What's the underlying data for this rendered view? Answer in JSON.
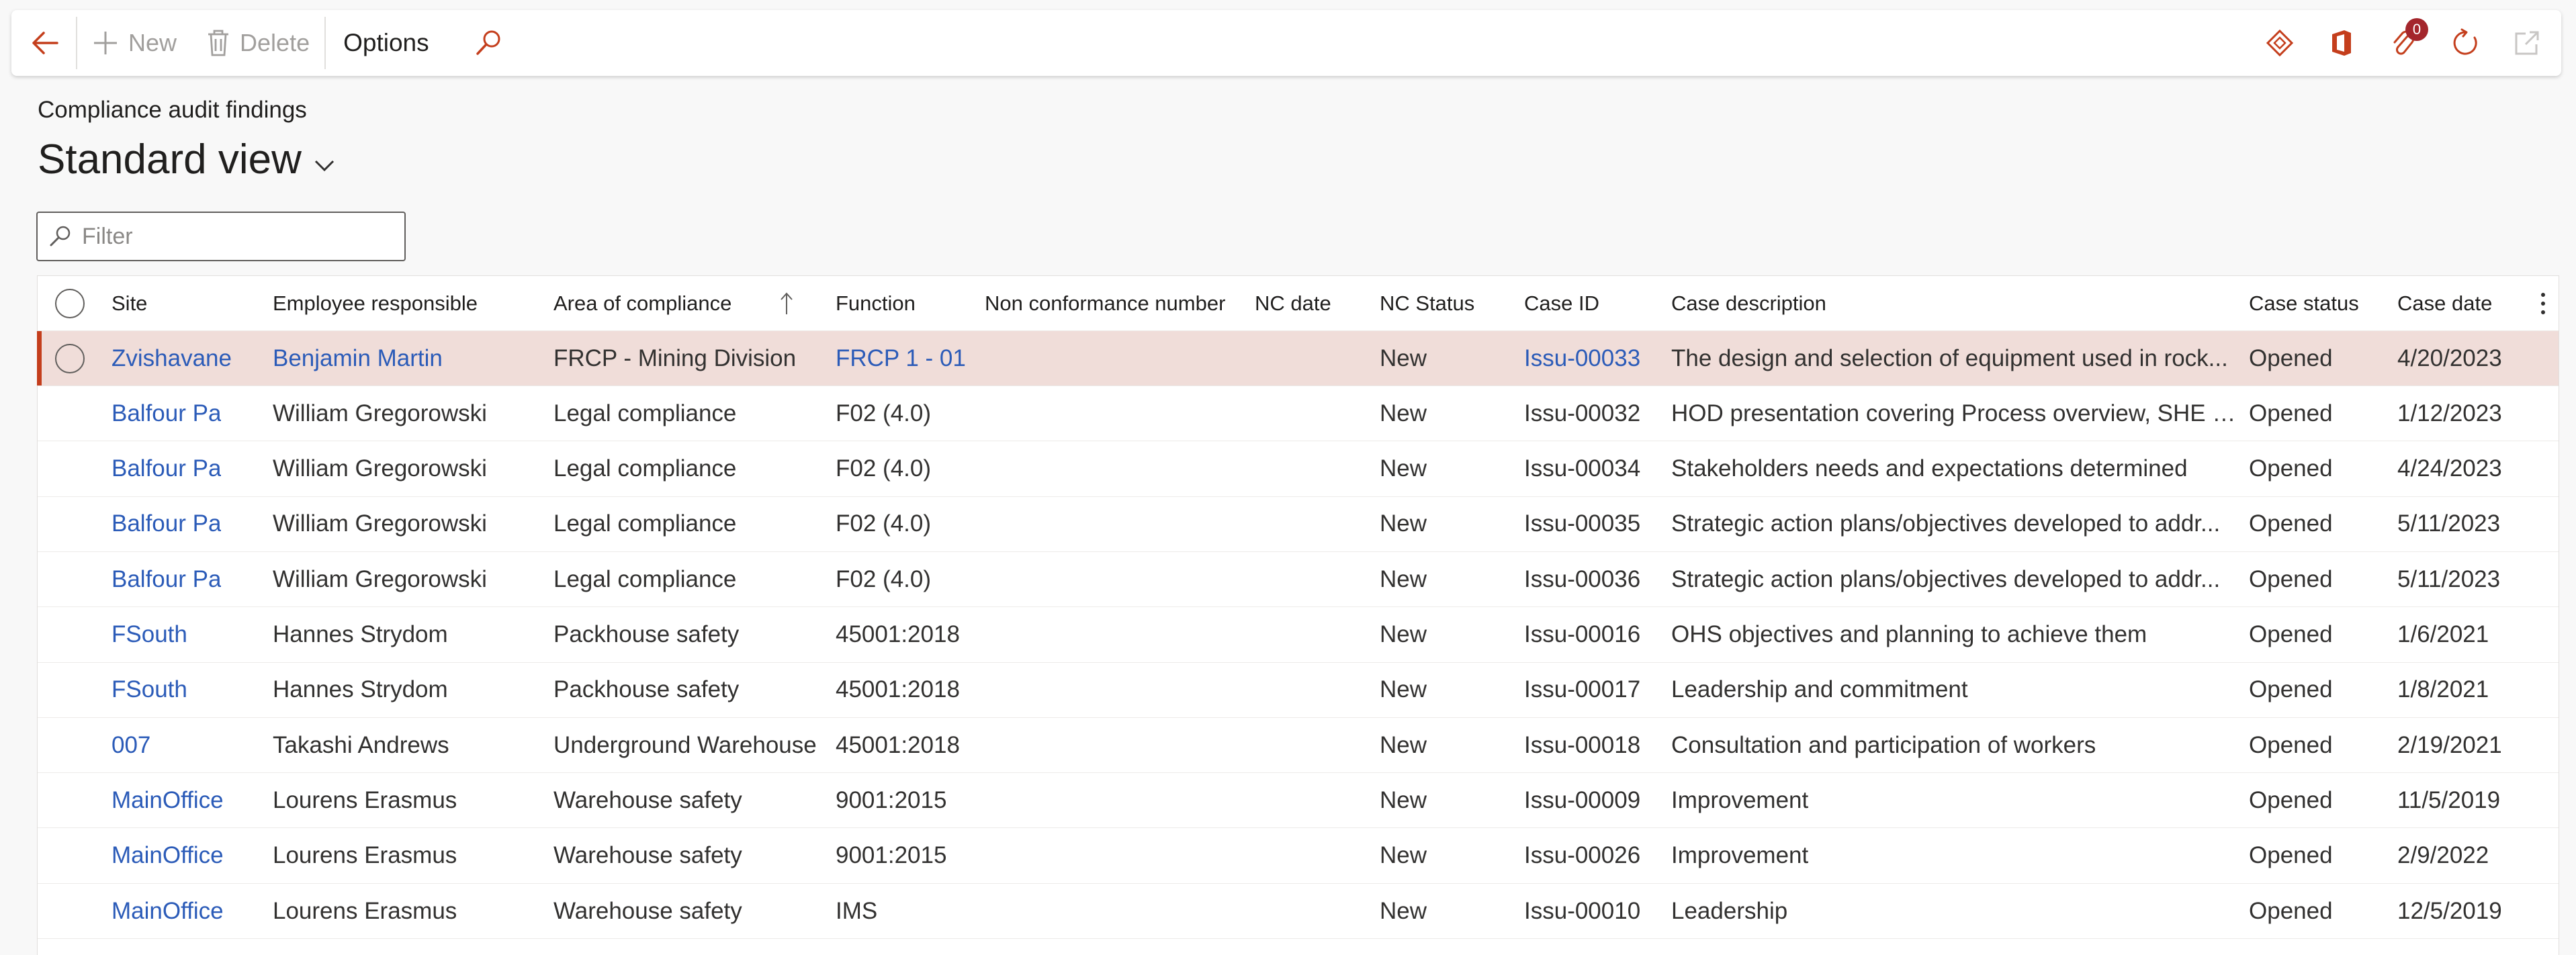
{
  "toolbar": {
    "new_label": "New",
    "delete_label": "Delete",
    "options_label": "Options",
    "attachments_count": "0"
  },
  "page": {
    "caption": "Compliance audit findings",
    "view_name": "Standard view",
    "filter_placeholder": "Filter"
  },
  "columns": {
    "site": "Site",
    "employee": "Employee responsible",
    "area": "Area of compliance",
    "function": "Function",
    "nc_number": "Non conformance number",
    "nc_date": "NC date",
    "nc_status": "NC Status",
    "case_id": "Case ID",
    "case_description": "Case description",
    "case_status": "Case status",
    "case_date": "Case date"
  },
  "rows": [
    {
      "site": "Zvishavane",
      "employee": "Benjamin Martin",
      "area": "FRCP - Mining Division",
      "function": "FRCP 1 - 01",
      "nc_number": "",
      "nc_date": "",
      "nc_status": "New",
      "case_id": "Issu-00033",
      "case_description": "The design and selection of equipment used in rock...",
      "case_status": "Opened",
      "case_date": "4/20/2023"
    },
    {
      "site": "Balfour Pa",
      "employee": "William Gregorowski",
      "area": "Legal compliance",
      "function": "F02 (4.0)",
      "nc_number": "",
      "nc_date": "",
      "nc_status": "New",
      "case_id": "Issu-00032",
      "case_description": "HOD presentation covering Process overview, SHE P...",
      "case_status": "Opened",
      "case_date": "1/12/2023"
    },
    {
      "site": "Balfour Pa",
      "employee": "William Gregorowski",
      "area": "Legal compliance",
      "function": "F02 (4.0)",
      "nc_number": "",
      "nc_date": "",
      "nc_status": "New",
      "case_id": "Issu-00034",
      "case_description": "Stakeholders needs and expectations determined",
      "case_status": "Opened",
      "case_date": "4/24/2023"
    },
    {
      "site": "Balfour Pa",
      "employee": "William Gregorowski",
      "area": "Legal compliance",
      "function": "F02 (4.0)",
      "nc_number": "",
      "nc_date": "",
      "nc_status": "New",
      "case_id": "Issu-00035",
      "case_description": "Strategic action plans/objectives developed to addr...",
      "case_status": "Opened",
      "case_date": "5/11/2023"
    },
    {
      "site": "Balfour Pa",
      "employee": "William Gregorowski",
      "area": "Legal compliance",
      "function": "F02 (4.0)",
      "nc_number": "",
      "nc_date": "",
      "nc_status": "New",
      "case_id": "Issu-00036",
      "case_description": "Strategic action plans/objectives developed to addr...",
      "case_status": "Opened",
      "case_date": "5/11/2023"
    },
    {
      "site": "FSouth",
      "employee": "Hannes Strydom",
      "area": "Packhouse safety",
      "function": "45001:2018",
      "nc_number": "",
      "nc_date": "",
      "nc_status": "New",
      "case_id": "Issu-00016",
      "case_description": "OHS objectives and planning to achieve them",
      "case_status": "Opened",
      "case_date": "1/6/2021"
    },
    {
      "site": "FSouth",
      "employee": "Hannes Strydom",
      "area": "Packhouse safety",
      "function": "45001:2018",
      "nc_number": "",
      "nc_date": "",
      "nc_status": "New",
      "case_id": "Issu-00017",
      "case_description": "Leadership and commitment",
      "case_status": "Opened",
      "case_date": "1/8/2021"
    },
    {
      "site": "007",
      "employee": "Takashi Andrews",
      "area": "Underground Warehouse",
      "function": "45001:2018",
      "nc_number": "",
      "nc_date": "",
      "nc_status": "New",
      "case_id": "Issu-00018",
      "case_description": "Consultation and participation of workers",
      "case_status": "Opened",
      "case_date": "2/19/2021"
    },
    {
      "site": "MainOffice",
      "employee": "Lourens Erasmus",
      "area": "Warehouse safety",
      "function": "9001:2015",
      "nc_number": "",
      "nc_date": "",
      "nc_status": "New",
      "case_id": "Issu-00009",
      "case_description": "Improvement",
      "case_status": "Opened",
      "case_date": "11/5/2019"
    },
    {
      "site": "MainOffice",
      "employee": "Lourens Erasmus",
      "area": "Warehouse safety",
      "function": "9001:2015",
      "nc_number": "",
      "nc_date": "",
      "nc_status": "New",
      "case_id": "Issu-00026",
      "case_description": "Improvement",
      "case_status": "Opened",
      "case_date": "2/9/2022"
    },
    {
      "site": "MainOffice",
      "employee": "Lourens Erasmus",
      "area": "Warehouse safety",
      "function": "IMS",
      "nc_number": "",
      "nc_date": "",
      "nc_status": "New",
      "case_id": "Issu-00010",
      "case_description": "Leadership",
      "case_status": "Opened",
      "case_date": "12/5/2019"
    }
  ],
  "colors": {
    "accent": "#c43e1c",
    "link": "#2b5bb8",
    "selected_row": "#f0ddd9"
  },
  "icons": {
    "back": "back-arrow-icon",
    "new": "plus-icon",
    "delete": "trash-icon",
    "search": "search-icon",
    "power_apps": "diamond-icon",
    "office": "office-icon",
    "attachments": "paperclip-icon",
    "refresh": "refresh-icon",
    "popout": "open-new-window-icon"
  }
}
